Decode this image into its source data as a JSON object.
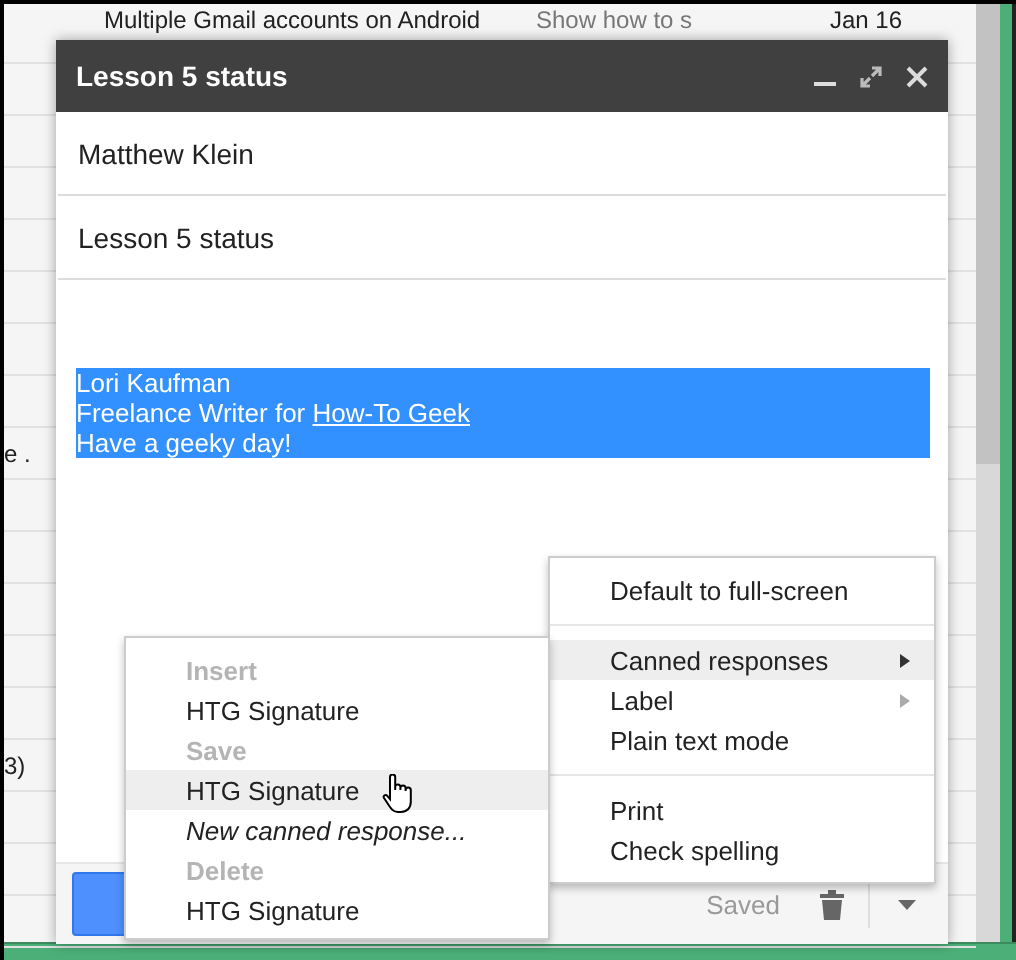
{
  "inbox": {
    "rows": [
      {
        "subject": "Multiple Gmail accounts on Android",
        "snippet": "Show how to s",
        "date": "Jan 16"
      },
      {},
      {},
      {},
      {},
      {},
      {},
      {},
      {
        "tail": "e ."
      },
      {},
      {},
      {},
      {},
      {},
      {
        "tail": "3)"
      },
      {},
      {},
      {}
    ]
  },
  "compose": {
    "title": "Lesson 5 status",
    "to": "Matthew Klein",
    "subject": "Lesson 5 status",
    "signature": {
      "selected": true,
      "lines": [
        {
          "text": "Lori Kaufman"
        },
        {
          "text": "Freelance Writer for ",
          "link": "How-To Geek"
        },
        {
          "text": "Have a geeky day!"
        }
      ]
    },
    "status": "Saved"
  },
  "menu": {
    "items": [
      {
        "kind": "item",
        "label": "Default to full-screen",
        "selected": false,
        "submenu": false
      },
      {
        "kind": "separator"
      },
      {
        "kind": "item",
        "label": "Canned responses",
        "selected": true,
        "submenu": true
      },
      {
        "kind": "item",
        "label": "Label",
        "selected": false,
        "submenu": true
      },
      {
        "kind": "item",
        "label": "Plain text mode",
        "selected": false,
        "submenu": false
      },
      {
        "kind": "separator"
      },
      {
        "kind": "item",
        "label": "Print",
        "selected": false,
        "submenu": false
      },
      {
        "kind": "item",
        "label": "Check spelling",
        "selected": false,
        "submenu": false
      }
    ]
  },
  "submenu": {
    "items": [
      {
        "kind": "header",
        "label": "Insert"
      },
      {
        "kind": "item",
        "label": "HTG Signature",
        "selected": false
      },
      {
        "kind": "header",
        "label": "Save"
      },
      {
        "kind": "item",
        "label": "HTG Signature",
        "selected": true
      },
      {
        "kind": "new",
        "label": "New canned response...",
        "selected": false
      },
      {
        "kind": "header",
        "label": "Delete"
      },
      {
        "kind": "item",
        "label": "HTG Signature",
        "selected": false
      }
    ]
  }
}
